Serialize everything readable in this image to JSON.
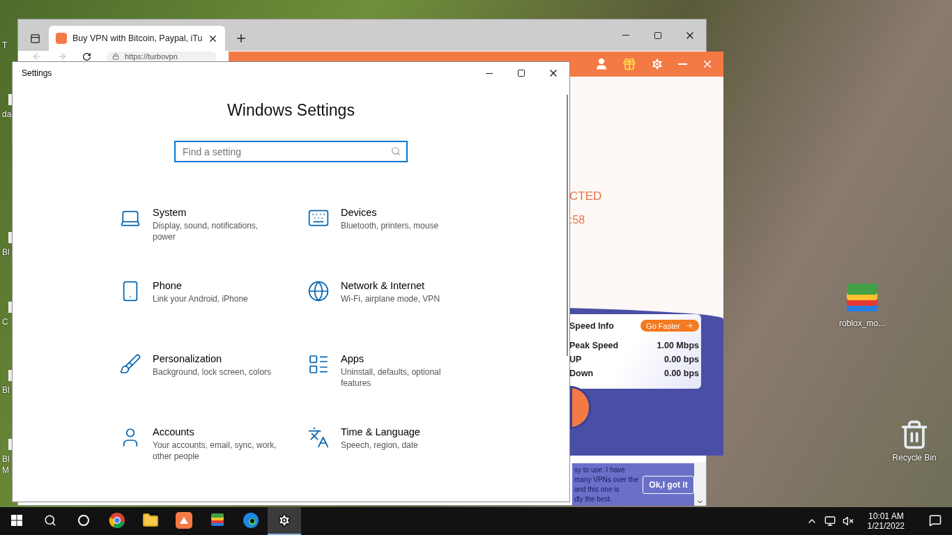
{
  "desktop": {
    "edge_labels": [
      "T",
      "da",
      "Bl",
      "C",
      "Bl",
      "Bl",
      "M"
    ],
    "icons": [
      {
        "label": "roblox_mo..."
      },
      {
        "label": "Recycle Bin"
      }
    ]
  },
  "browser": {
    "tabs": [
      {
        "title": "Buy VPN with Bitcoin, Paypal, iTu",
        "selected": true
      }
    ],
    "address": "https://turbovpn",
    "page": {
      "review_lines": [
        "sy to use. I have",
        "many VPNs over the",
        "and this one is",
        "dly the best."
      ],
      "dismiss_button": "Ok,I got it"
    }
  },
  "vpn_app": {
    "status": "CTED",
    "timer": ":58",
    "speed_info": {
      "title": "Speed Info",
      "button": "Go Faster",
      "rows": [
        {
          "label": "Peak Speed",
          "value": "1.00 Mbps"
        },
        {
          "label": "UP",
          "value": "0.00 bps"
        },
        {
          "label": "Down",
          "value": "0.00 bps"
        }
      ]
    }
  },
  "settings": {
    "window_title": "Settings",
    "heading": "Windows Settings",
    "search": {
      "placeholder": "Find a setting"
    },
    "categories": [
      {
        "name": "System",
        "description": "Display, sound, notifications, power"
      },
      {
        "name": "Devices",
        "description": "Bluetooth, printers, mouse"
      },
      {
        "name": "Phone",
        "description": "Link your Android, iPhone"
      },
      {
        "name": "Network & Internet",
        "description": "Wi-Fi, airplane mode, VPN"
      },
      {
        "name": "Personalization",
        "description": "Background, lock screen, colors"
      },
      {
        "name": "Apps",
        "description": "Uninstall, defaults, optional features"
      },
      {
        "name": "Accounts",
        "description": "Your accounts, email, sync, work, other people"
      },
      {
        "name": "Time & Language",
        "description": "Speech, region, date"
      }
    ]
  },
  "taskbar": {
    "apps": [
      {
        "selected": false
      },
      {
        "selected": false
      },
      {
        "selected": false
      },
      {
        "selected": false
      },
      {
        "selected": false
      },
      {
        "selected": true
      }
    ],
    "time": "10:01 AM",
    "date": "1/21/2022"
  }
}
